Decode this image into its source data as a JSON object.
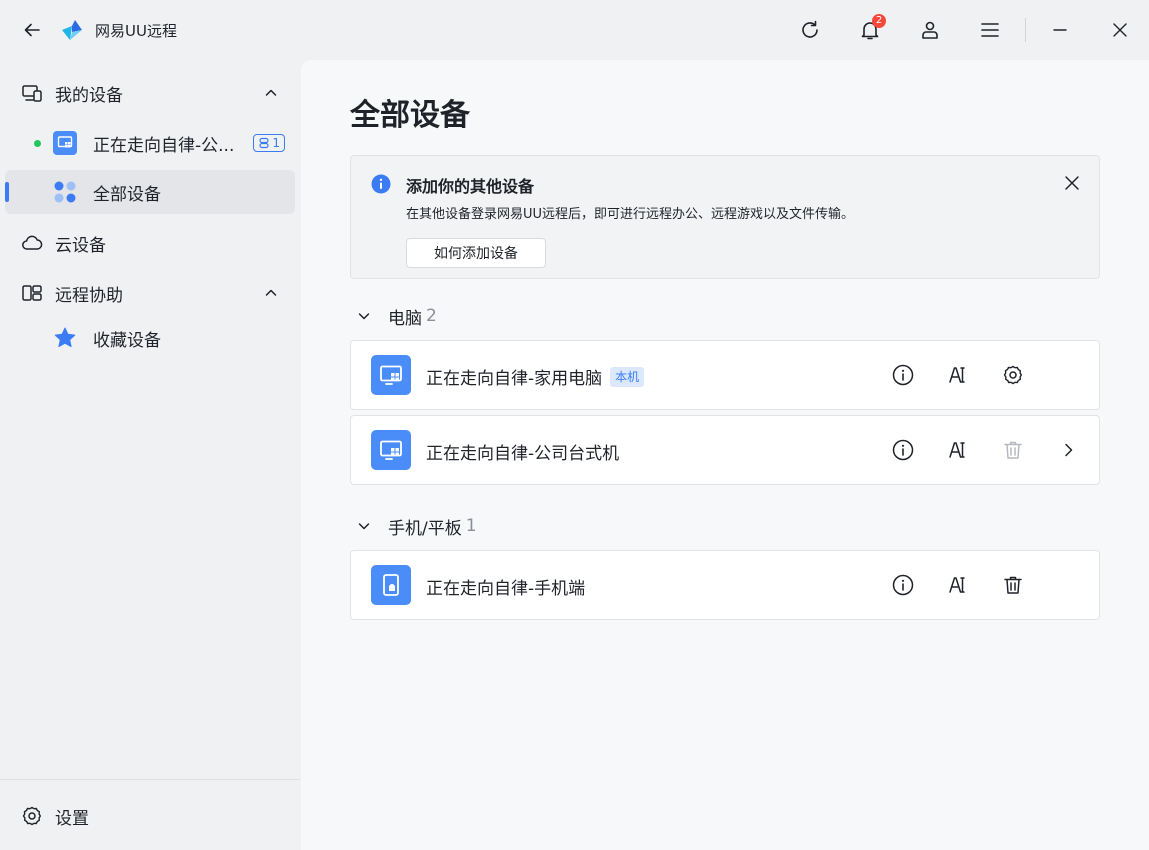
{
  "titlebar": {
    "app_title": "网易UU远程",
    "notification_count": "2"
  },
  "sidebar": {
    "my_devices": {
      "label": "我的设备"
    },
    "current_device": {
      "label": "正在走向自律-公...",
      "connections": "1"
    },
    "all_devices": {
      "label": "全部设备"
    },
    "cloud_devices": {
      "label": "云设备"
    },
    "remote_assist": {
      "label": "远程协助"
    },
    "favorites": {
      "label": "收藏设备"
    },
    "settings": {
      "label": "设置"
    }
  },
  "main": {
    "title": "全部设备",
    "info": {
      "title": "添加你的其他设备",
      "description": "在其他设备登录网易UU远程后，即可进行远程办公、远程游戏以及文件传输。",
      "button": "如何添加设备"
    },
    "groups": [
      {
        "name": "电脑",
        "count": "2"
      },
      {
        "name": "手机/平板",
        "count": "1"
      }
    ],
    "devices": [
      {
        "name": "正在走向自律-家用电脑",
        "tag": "本机"
      },
      {
        "name": "正在走向自律-公司台式机"
      },
      {
        "name": "正在走向自律-手机端"
      }
    ]
  },
  "colors": {
    "accent": "#3b7cf5",
    "device_icon": "#4b8df8",
    "online": "#22c55e",
    "badge": "#f5483b"
  }
}
